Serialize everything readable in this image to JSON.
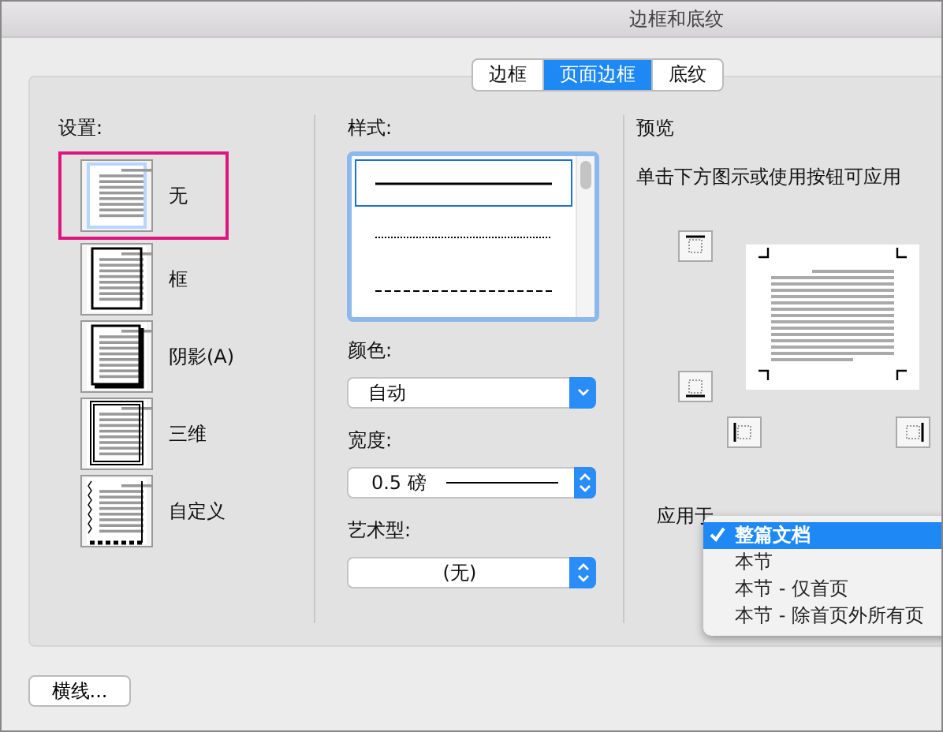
{
  "window": {
    "title": "边框和底纹"
  },
  "tabs": [
    {
      "label": "边框",
      "selected": false
    },
    {
      "label": "页面边框",
      "selected": true
    },
    {
      "label": "底纹",
      "selected": false
    }
  ],
  "settings": {
    "label": "设置:",
    "items": [
      {
        "label": "无",
        "kind": "none",
        "selected": true
      },
      {
        "label": "框",
        "kind": "box",
        "selected": false
      },
      {
        "label": "阴影(A)",
        "kind": "shadow",
        "selected": false
      },
      {
        "label": "三维",
        "kind": "threed",
        "selected": false
      },
      {
        "label": "自定义",
        "kind": "custom",
        "selected": false
      }
    ]
  },
  "style": {
    "label": "样式:",
    "items": [
      {
        "kind": "solid",
        "selected": true
      },
      {
        "kind": "dotted",
        "selected": false
      },
      {
        "kind": "dashed",
        "selected": false
      }
    ]
  },
  "color": {
    "label": "颜色:",
    "value": "自动"
  },
  "width": {
    "label": "宽度:",
    "value": "0.5 磅"
  },
  "art": {
    "label": "艺术型:",
    "value": "(无)"
  },
  "preview": {
    "label": "预览",
    "hint": "单击下方图示或使用按钮可应用"
  },
  "apply_to": {
    "label": "应用于",
    "options": [
      {
        "label": "整篇文档",
        "selected": true
      },
      {
        "label": "本节",
        "selected": false
      },
      {
        "label": "本节 - 仅首页",
        "selected": false
      },
      {
        "label": "本节 - 除首页外所有页",
        "selected": false
      }
    ]
  },
  "buttons": [
    {
      "label": "横线..."
    }
  ]
}
